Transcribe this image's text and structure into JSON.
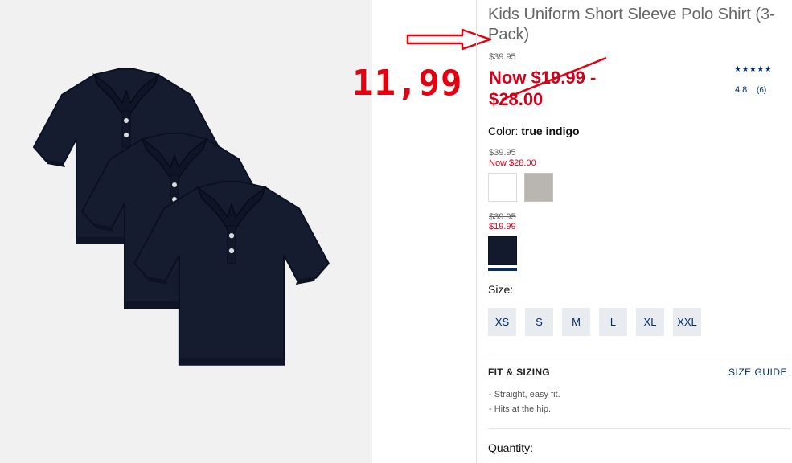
{
  "product": {
    "title": "Kids Uniform Short Sleeve Polo Shirt (3-Pack)",
    "original_price": "$39.95",
    "sale_price": "Now $19.99 - $28.00",
    "rating": "4.8",
    "review_count": "(6)",
    "stars": "★★★★★"
  },
  "annotation": {
    "price": "11,99",
    "color": "#e3000f"
  },
  "color": {
    "label": "Color: ",
    "value": "true indigo",
    "groups": [
      {
        "original": "$39.95",
        "now": "Now $28.00",
        "swatches": [
          "white",
          "heather-gray"
        ]
      },
      {
        "original": "$39.95",
        "now": "$19.99",
        "swatches": [
          "true-indigo"
        ]
      }
    ]
  },
  "size": {
    "label": "Size:",
    "options": [
      "XS",
      "S",
      "M",
      "L",
      "XL",
      "XXL"
    ]
  },
  "fit": {
    "title": "FIT & SIZING",
    "size_guide": "SIZE GUIDE",
    "bullets": [
      "- Straight, easy fit.",
      "- Hits at the hip."
    ]
  },
  "quantity": {
    "label": "Quantity:"
  },
  "colors": {
    "brand_navy": "#002e6d",
    "sale_red": "#d0021b",
    "shirt_navy": "#141a2e"
  }
}
